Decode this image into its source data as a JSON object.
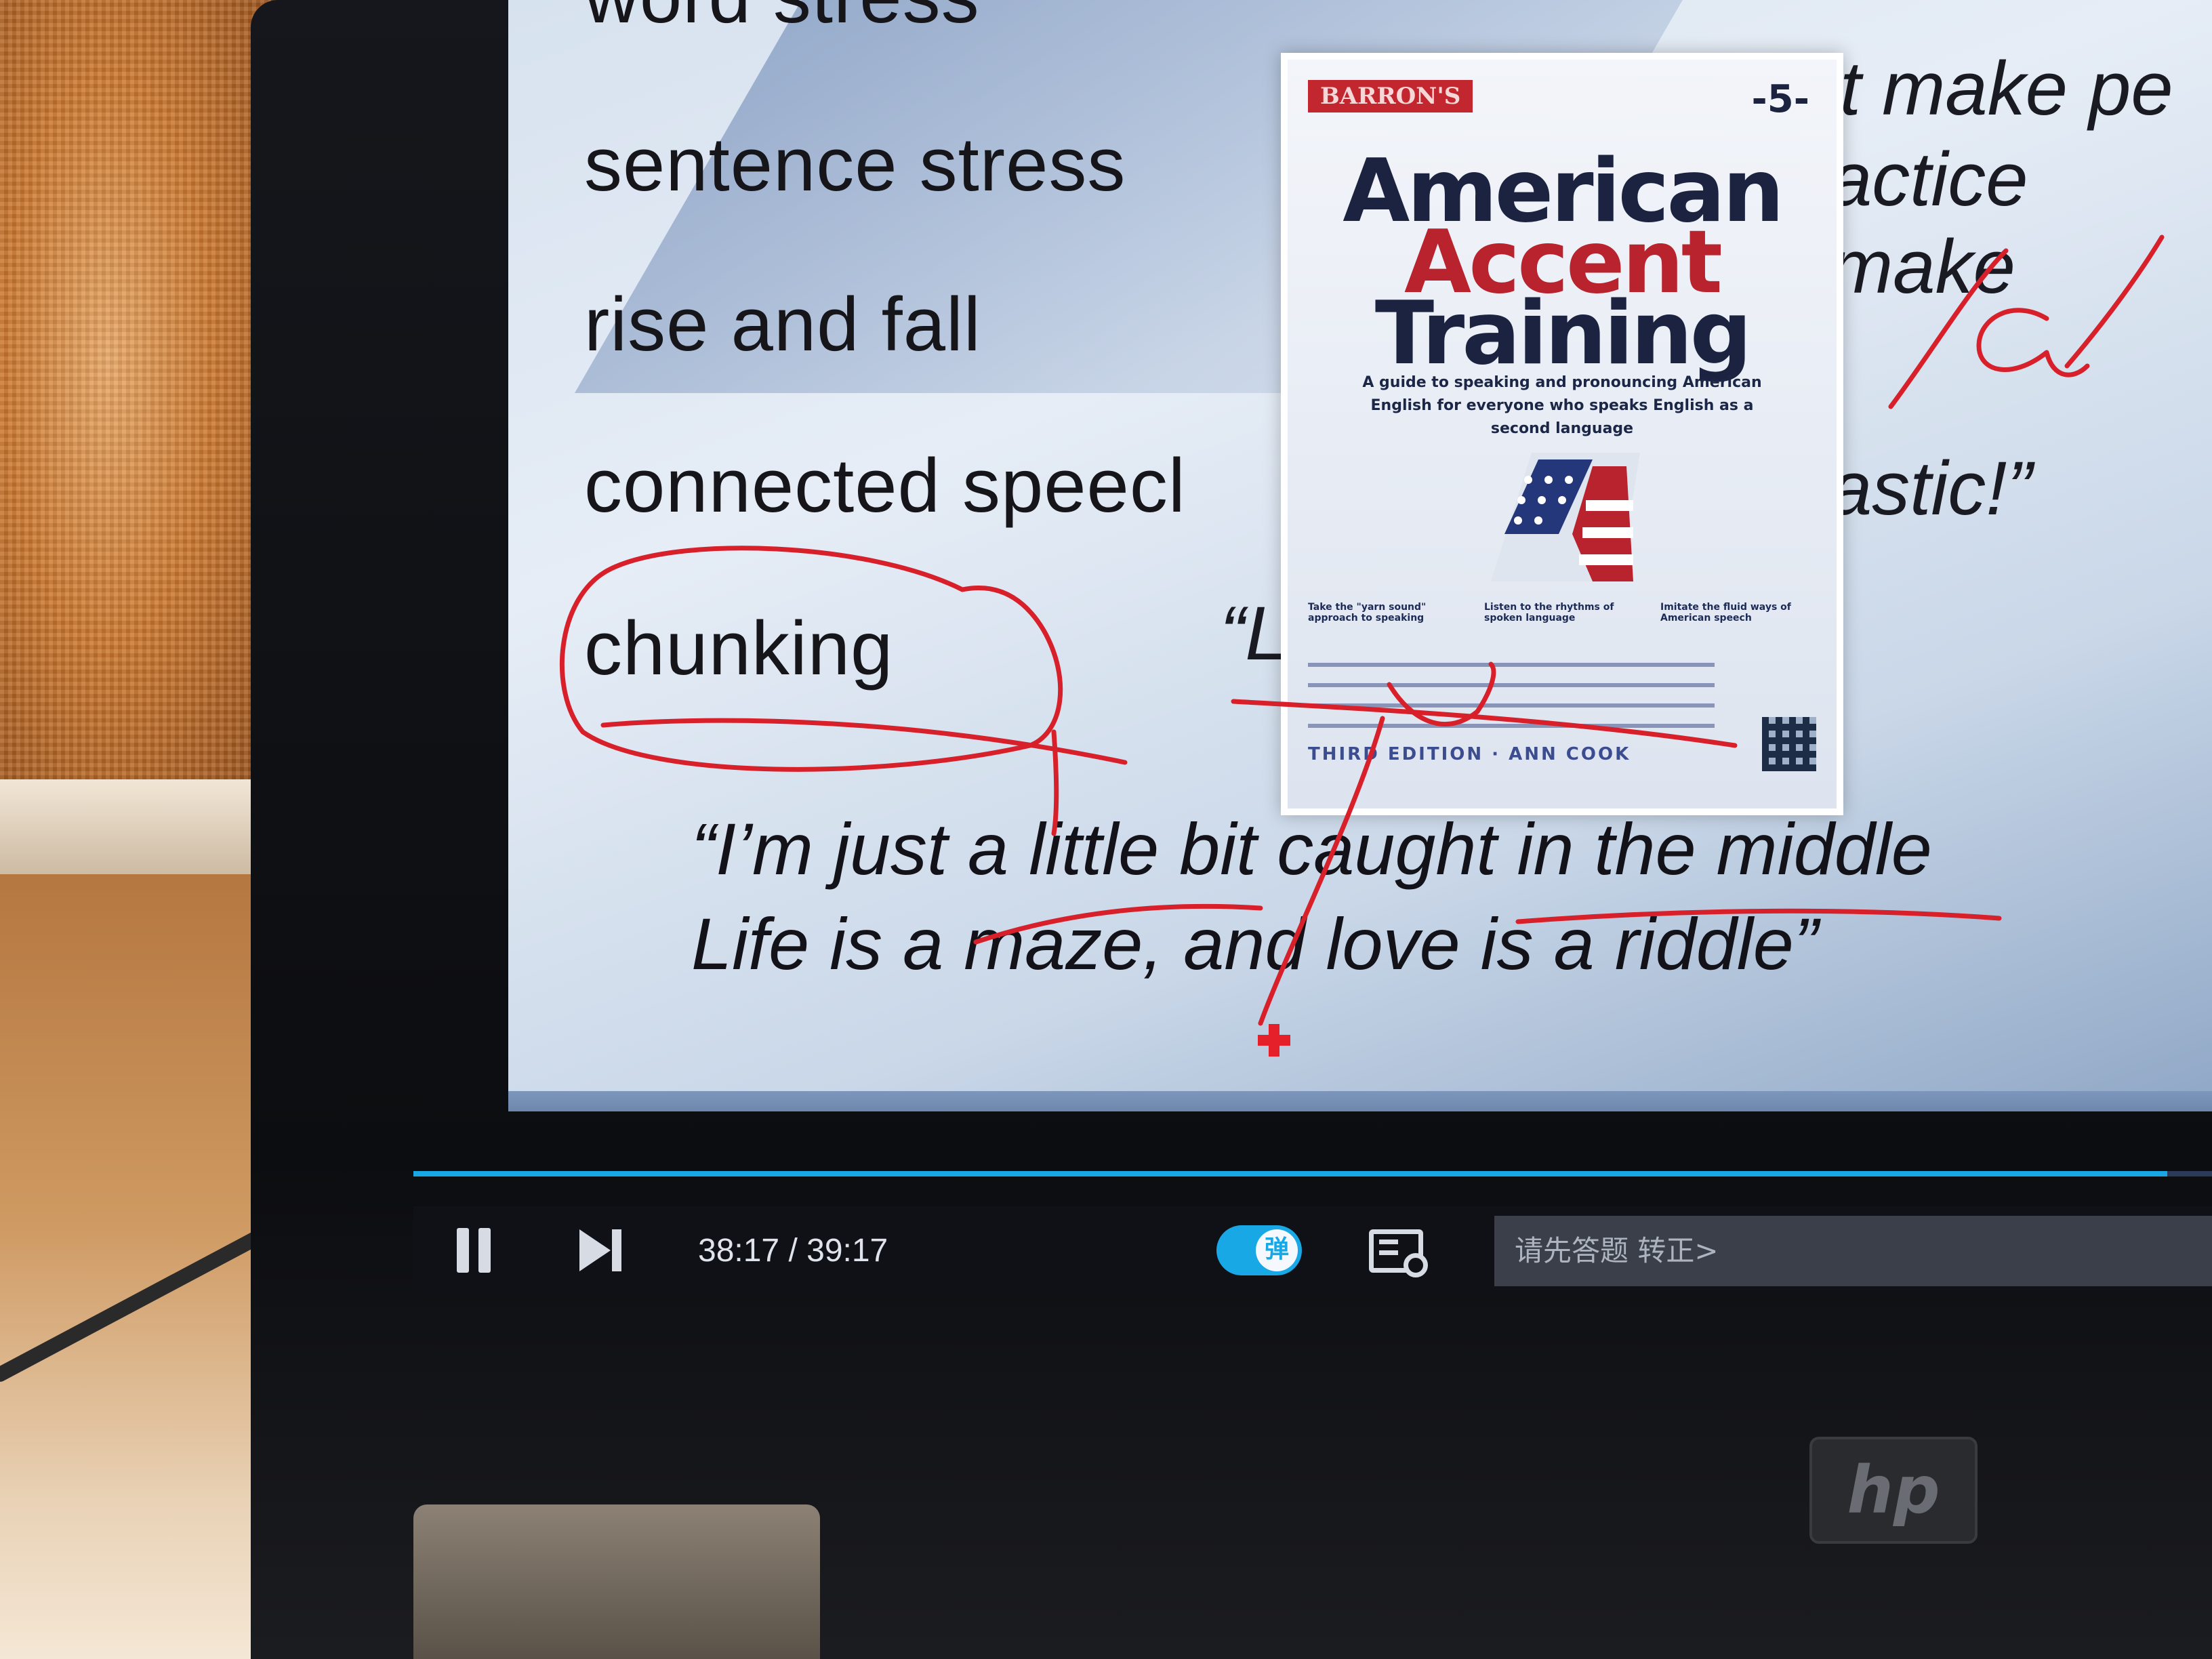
{
  "slide": {
    "terms": [
      "word stress",
      "sentence stress",
      "rise and fall",
      "connected speecl",
      "chunking"
    ],
    "right_fragments": [
      "’t make pe",
      "actice make",
      "astic!”"
    ],
    "quote_open": "“L",
    "lyrics_line1": "“I’m just a little bit caught in the middle",
    "lyrics_line2": "Life is a maze, and love is a riddle”",
    "annotation_symbol": "/a/"
  },
  "book": {
    "publisher": "BARRON'S",
    "edition_mark": "-5-",
    "title_line1": "American",
    "title_line2": "Accent",
    "title_line3": "Training",
    "subtitle": "A guide to speaking and pronouncing American English for everyone who speaks English as a second language",
    "bullets": [
      "Take the \"yarn sound\" approach to speaking",
      "Listen to the rhythms of spoken language",
      "Imitate the fluid ways of American speech"
    ],
    "footer": "THIRD EDITION · ANN COOK",
    "colors": {
      "title_dark": "#1b2340",
      "title_red": "#b8232d"
    }
  },
  "player": {
    "progress": 0.975,
    "time": "38:17 / 39:17",
    "danmaku_toggle_label": "弹",
    "danmaku_input_placeholder": "请先答题 转正>",
    "accent_color": "#19a8e6"
  },
  "laptop": {
    "brand": "hp"
  }
}
